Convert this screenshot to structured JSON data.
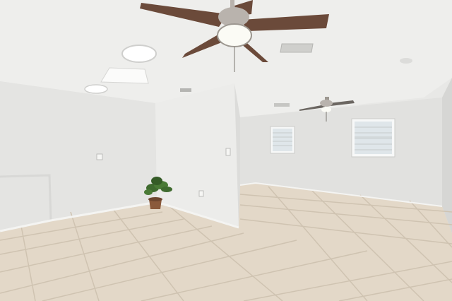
{
  "scene": {
    "description_kind": "photo",
    "subject": "empty-room-interior",
    "elements": [
      "ceiling-fan-front",
      "ceiling-fan-back",
      "ceiling-light",
      "skylight",
      "air-vent",
      "windows",
      "potted-plant",
      "tile-floor"
    ]
  },
  "colors": {
    "ceiling": "#eeeeec",
    "wall_left": "#e4e4e2",
    "wall_pillar": "#ececea",
    "wall_back": "#e1e1df",
    "floor": "#e3d8c8",
    "grout": "#c9bca9",
    "fan_blade": "#6b4a3a",
    "fan_metal": "#b9b3ad",
    "plant": "#3f6b2f",
    "pot": "#8a5a3c",
    "window_glass": "#dfe6ea"
  }
}
